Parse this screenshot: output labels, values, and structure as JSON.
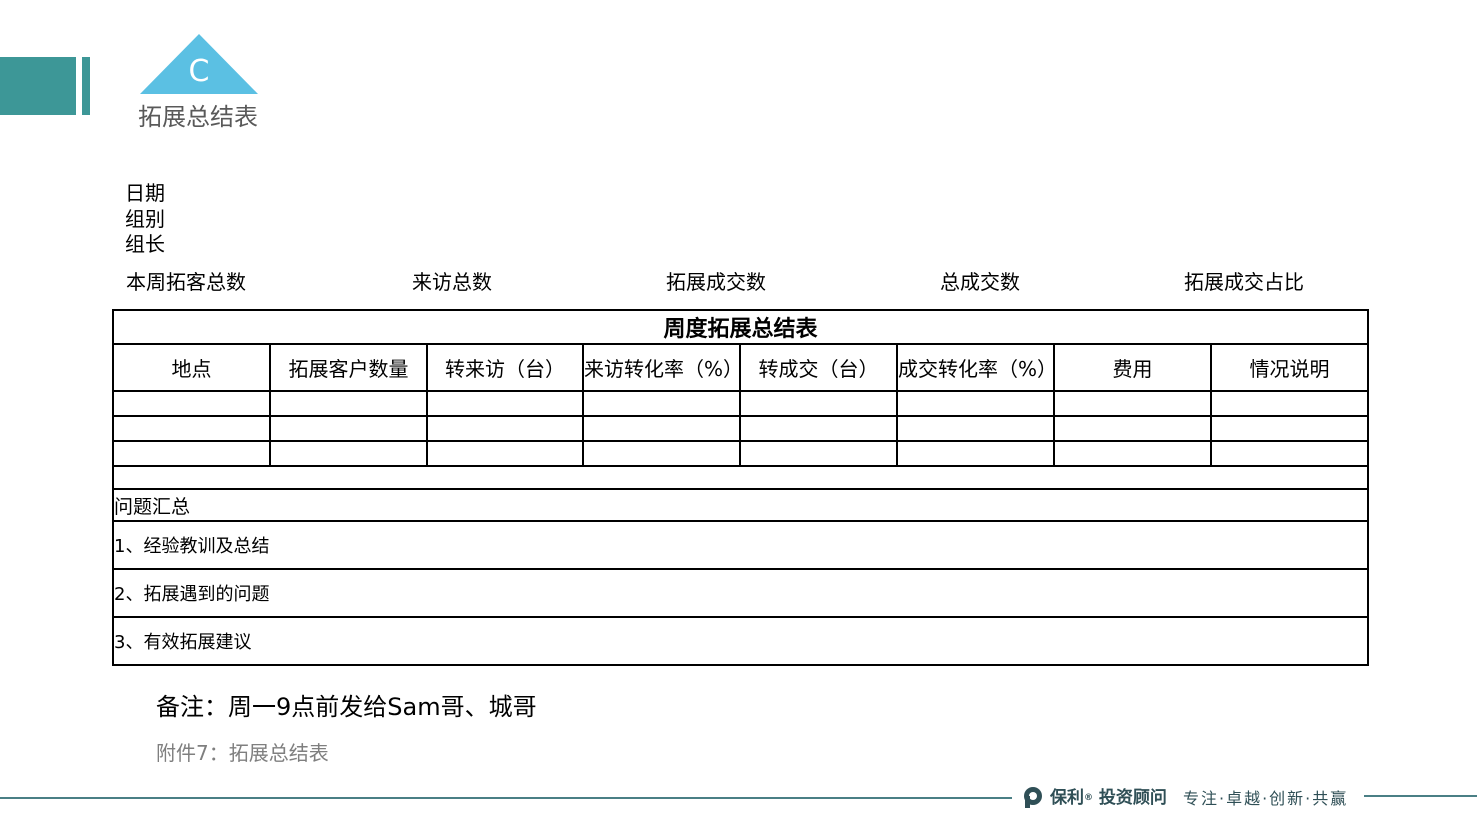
{
  "header": {
    "section_letter": "C",
    "section_title": "拓展总结表",
    "accent_color": "#3d9797",
    "triangle_color": "#5bc0e3"
  },
  "meta": {
    "date_label": "日期",
    "group_label": "组别",
    "leader_label": "组长"
  },
  "stats": {
    "weekly_prospects": "本周拓客总数",
    "total_visits": "来访总数",
    "expansion_deals": "拓展成交数",
    "total_deals": "总成交数",
    "expansion_deal_ratio": "拓展成交占比"
  },
  "table": {
    "title": "周度拓展总结表",
    "columns": [
      "地点",
      "拓展客户数量",
      "转来访（台）",
      "来访转化率（%）",
      "转成交（台）",
      "成交转化率（%）",
      "费用",
      "情况说明"
    ],
    "issues_label": "问题汇总",
    "items": [
      "1、经验教训及总结",
      "2、拓展遇到的问题",
      "3、有效拓展建议"
    ]
  },
  "note": "备注：周一9点前发给Sam哥、城哥",
  "attachment": "附件7：拓展总结表",
  "footer": {
    "brand": "保利",
    "brand_sub": "投资顾问",
    "slogan": "专注·卓越·创新·共赢",
    "line_color": "#4a7f85"
  }
}
